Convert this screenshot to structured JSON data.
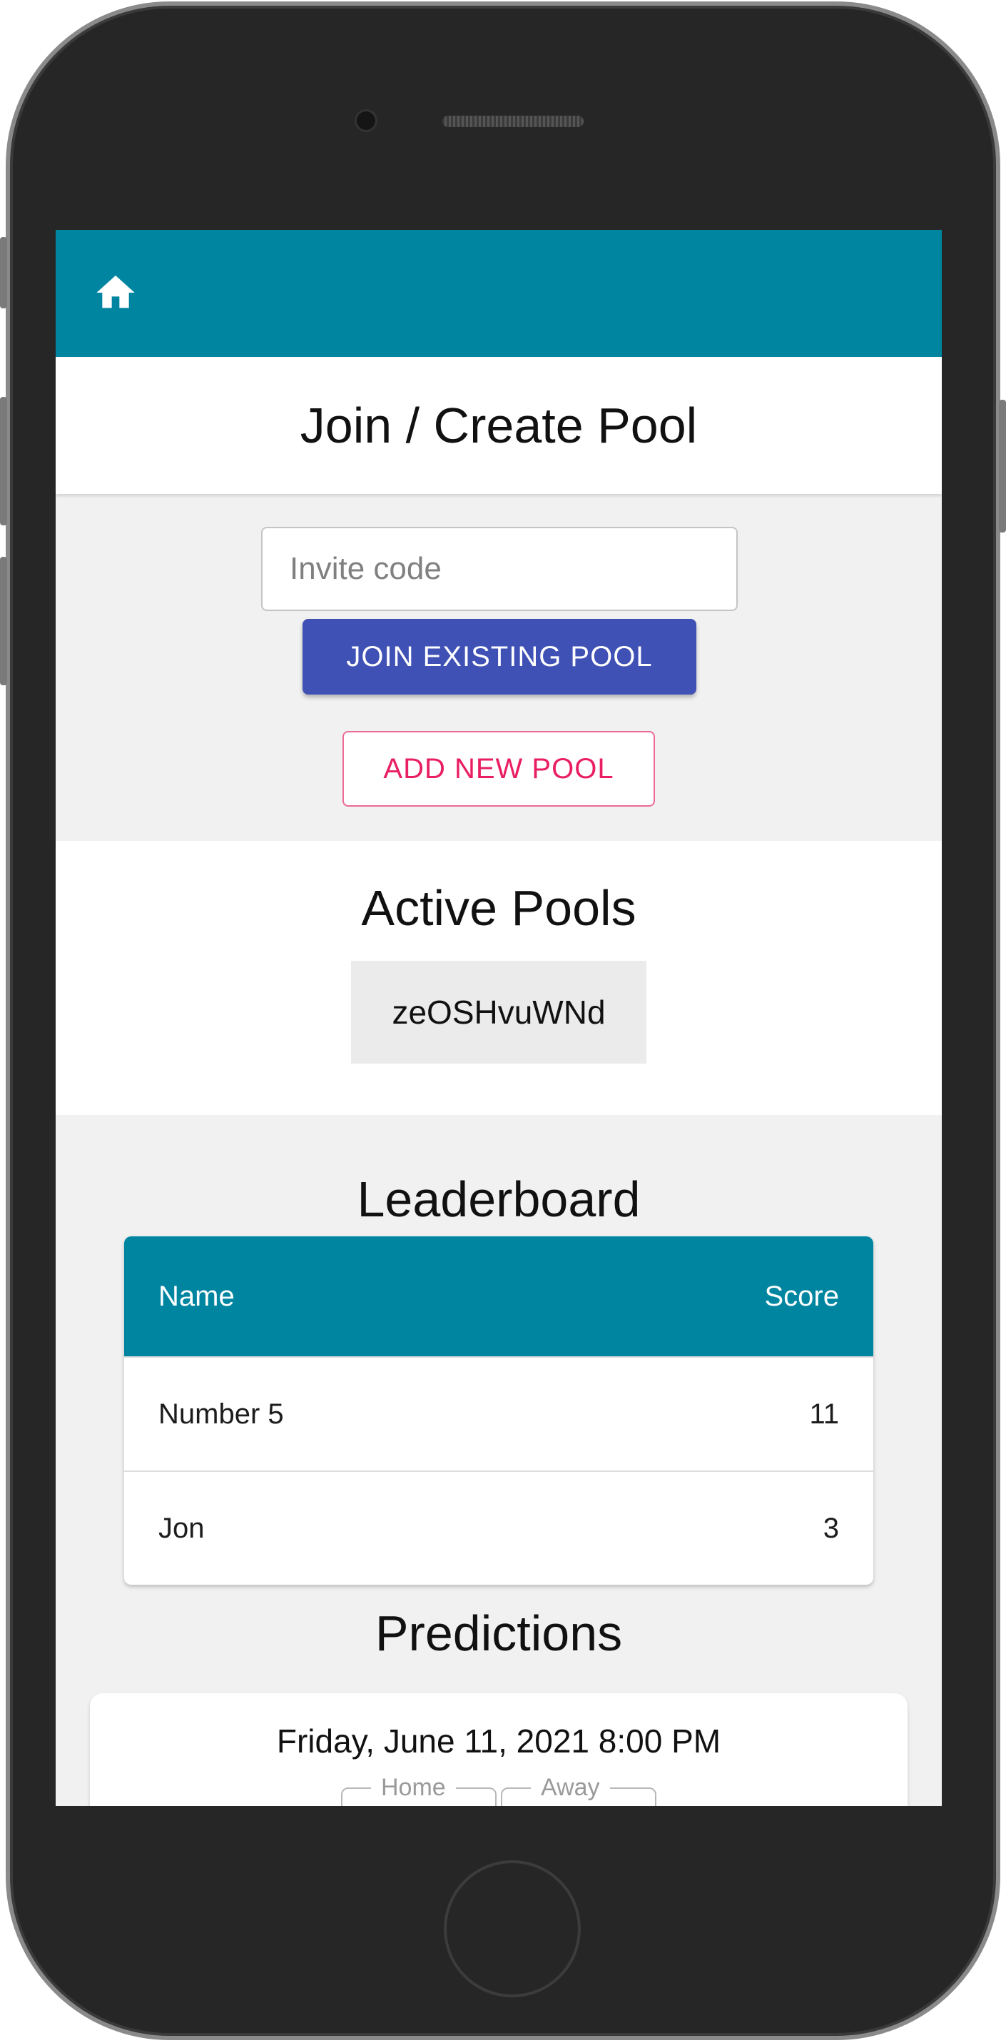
{
  "app": {
    "header_icon": "home-icon",
    "accent_color": "#0085a1"
  },
  "title": "Join / Create Pool",
  "join": {
    "invite_placeholder": "Invite code",
    "invite_value": "",
    "join_button": "JOIN EXISTING POOL",
    "add_button": "ADD NEW POOL"
  },
  "active_pools": {
    "heading": "Active Pools",
    "items": [
      "zeOSHvuWNd"
    ]
  },
  "leaderboard": {
    "heading": "Leaderboard",
    "columns": [
      "Name",
      "Score"
    ],
    "rows": [
      {
        "name": "Number 5",
        "score": "11"
      },
      {
        "name": "Jon",
        "score": "3"
      }
    ]
  },
  "predictions": {
    "heading": "Predictions",
    "matches": [
      {
        "date": "Friday, June 11, 2021 8:00 PM",
        "home_label": "Home",
        "away_label": "Away"
      }
    ]
  },
  "colors": {
    "primary_button": "#3f51b5",
    "secondary_button": "#e91e63"
  }
}
